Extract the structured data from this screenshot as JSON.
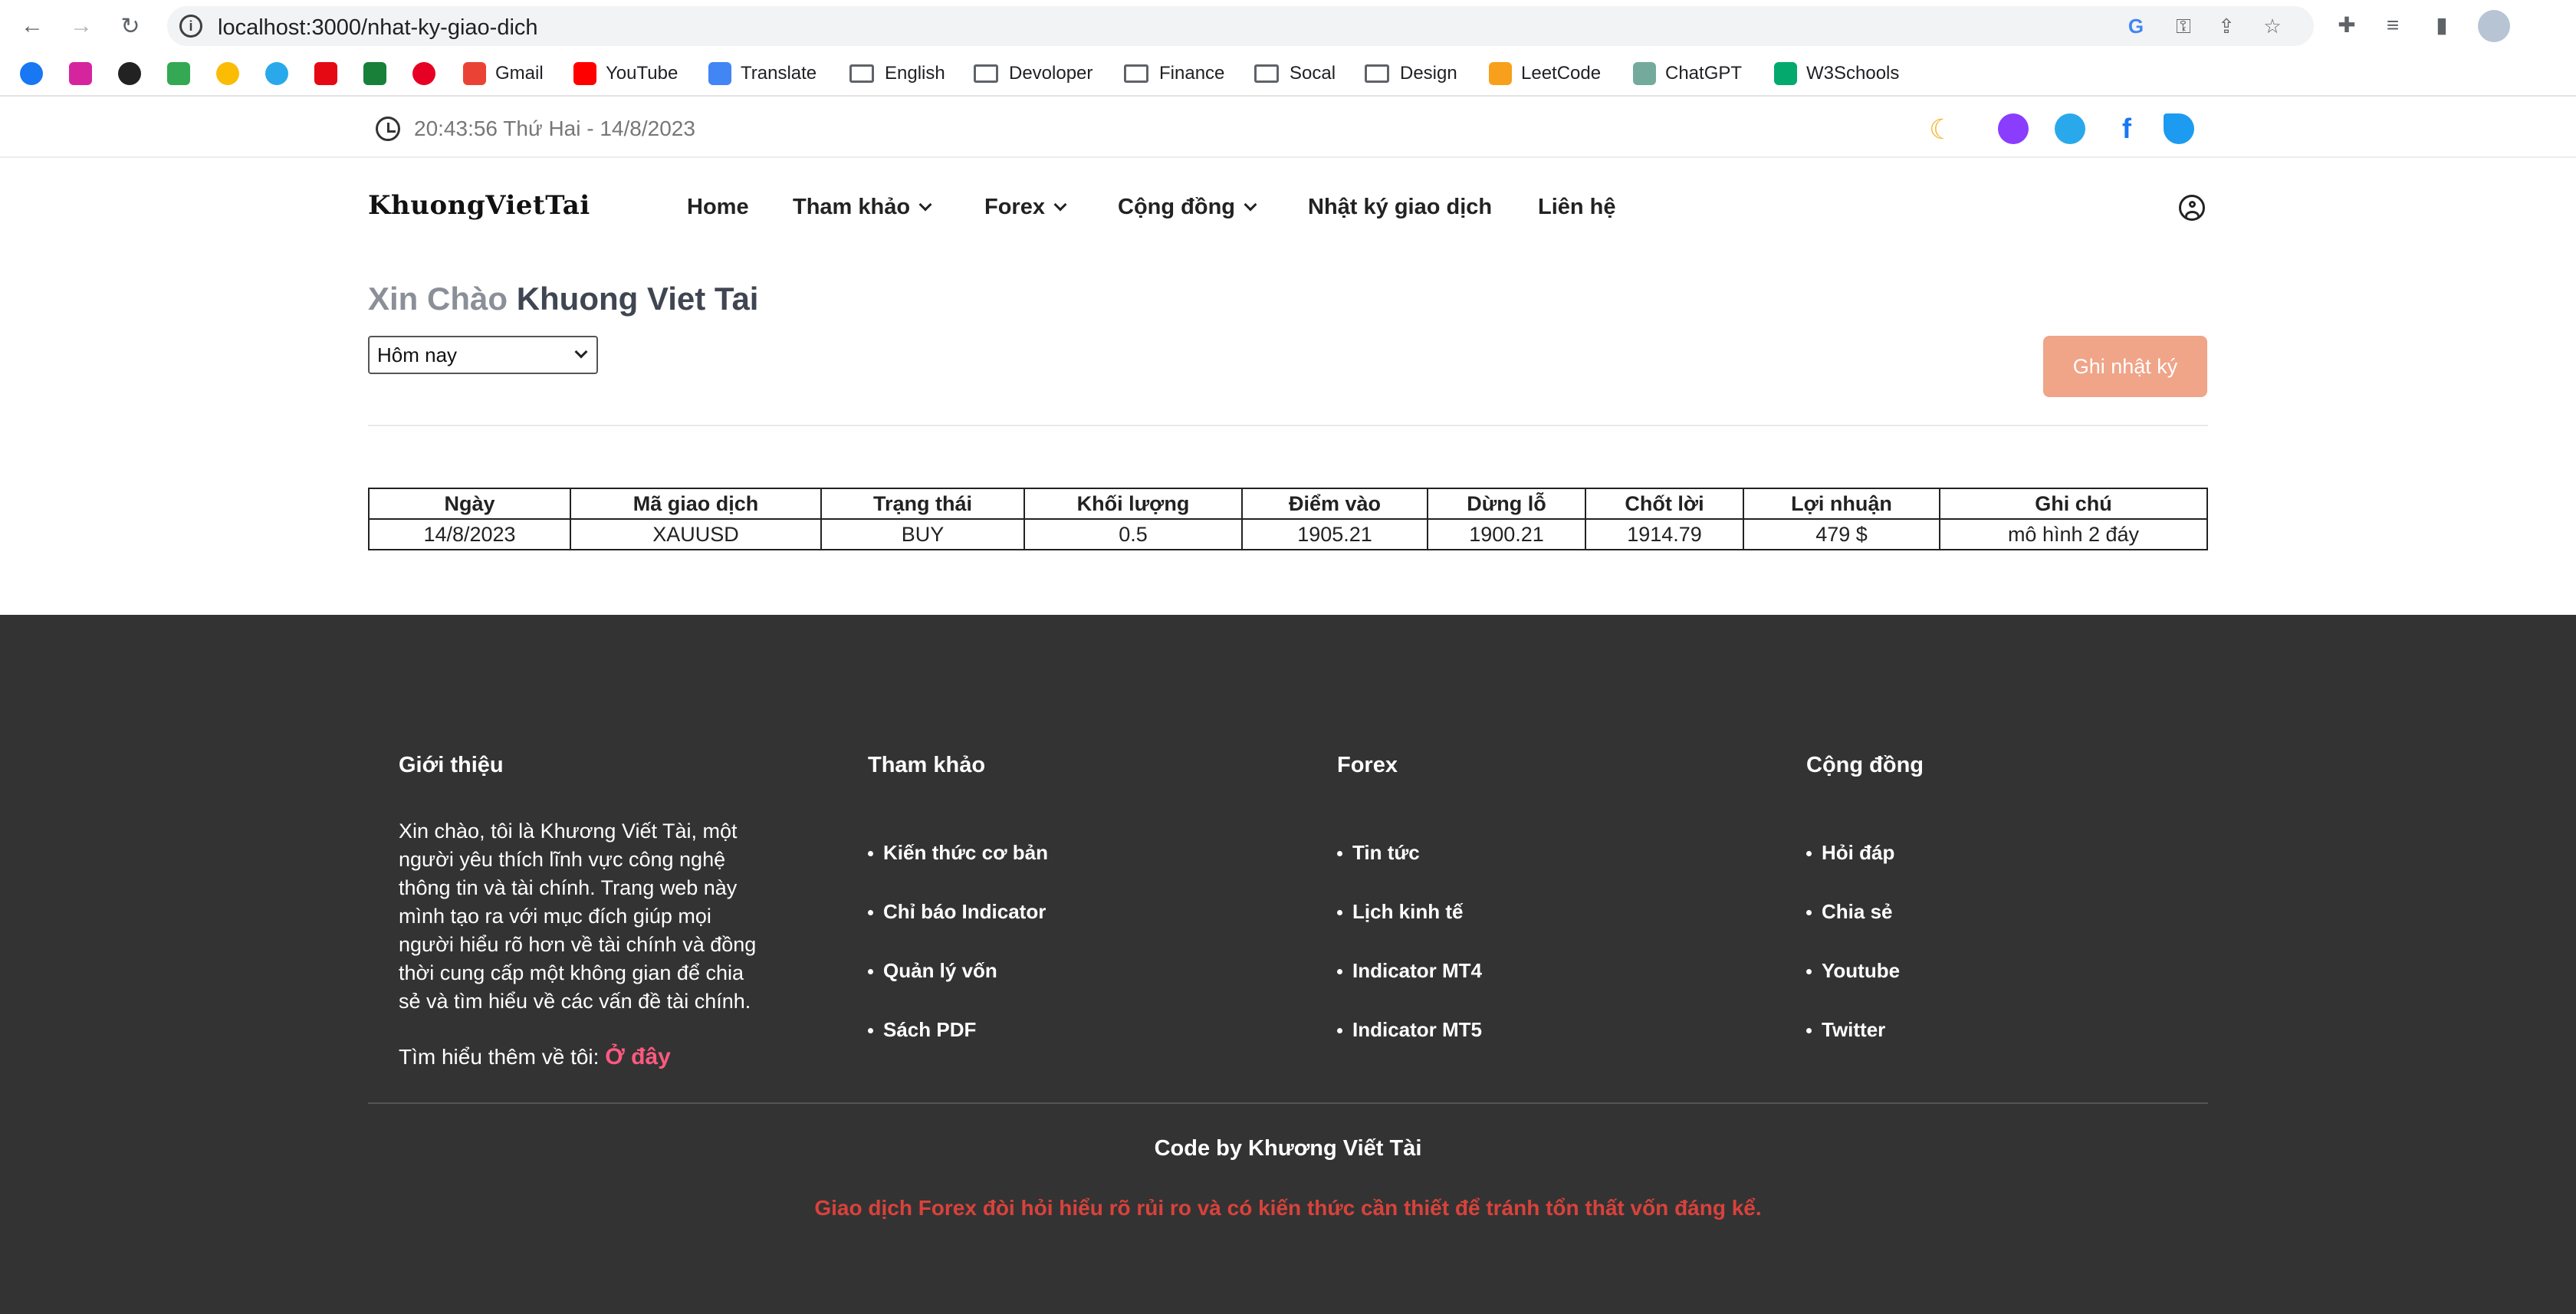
{
  "browser": {
    "url": "localhost:3000/nhat-ky-giao-dich",
    "bookmarks": [
      "Gmail",
      "YouTube",
      "Translate",
      "English",
      "Devoloper",
      "Finance",
      "Socal",
      "Design",
      "LeetCode",
      "ChatGPT",
      "W3Schools"
    ]
  },
  "topbar": {
    "datetime": "20:43:56 Thứ Hai - 14/8/2023"
  },
  "navbar": {
    "brand": "KhuongVietTai",
    "items": [
      "Home",
      "Tham khảo",
      "Forex",
      "Cộng đồng",
      "Nhật ký giao dịch",
      "Liên hệ"
    ]
  },
  "greeting": {
    "prefix": "Xin Chào",
    "name": "Khuong Viet Tai"
  },
  "filter": {
    "selected": "Hôm nay"
  },
  "log_button": "Ghi nhật ký",
  "table": {
    "headers": [
      "Ngày",
      "Mã giao dịch",
      "Trạng thái",
      "Khối lượng",
      "Điểm vào",
      "Dừng lỗ",
      "Chốt lời",
      "Lợi nhuận",
      "Ghi chú"
    ],
    "rows": [
      [
        "14/8/2023",
        "XAUUSD",
        "BUY",
        "0.5",
        "1905.21",
        "1900.21",
        "1914.79",
        "479 $",
        "mô hình 2 đáy"
      ]
    ]
  },
  "footer": {
    "intro_title": "Giới thiệu",
    "intro_text": "Xin chào, tôi là Khương Viết Tài, một người yêu thích lĩnh vực công nghệ thông tin và tài chính. Trang web này mình tạo ra với mục đích giúp mọi người hiểu rõ hơn về tài chính và đồng thời cung cấp một không gian để chia sẻ và tìm hiểu về các vấn đề tài chính.",
    "more_label": "Tìm hiểu thêm về tôi:",
    "more_link": "Ở đây",
    "columns": [
      {
        "title": "Tham khảo",
        "items": [
          "Kiến thức cơ bản",
          "Chỉ báo Indicator",
          "Quản lý vốn",
          "Sách PDF"
        ]
      },
      {
        "title": "Forex",
        "items": [
          "Tin tức",
          "Lịch kinh tế",
          "Indicator MT4",
          "Indicator MT5"
        ]
      },
      {
        "title": "Cộng đồng",
        "items": [
          "Hỏi đáp",
          "Chia sẻ",
          "Youtube",
          "Twitter"
        ]
      }
    ],
    "credit": "Code by Khương Viết Tài",
    "warning": "Giao dịch Forex đòi hỏi hiểu rõ rủi ro và có kiến thức cần thiết để tránh tổn thất vốn đáng kể."
  },
  "colors": {
    "accent_button": "#f0a488",
    "footer_bg": "#333333",
    "warning": "#d9423b",
    "link": "#ff5a80"
  }
}
